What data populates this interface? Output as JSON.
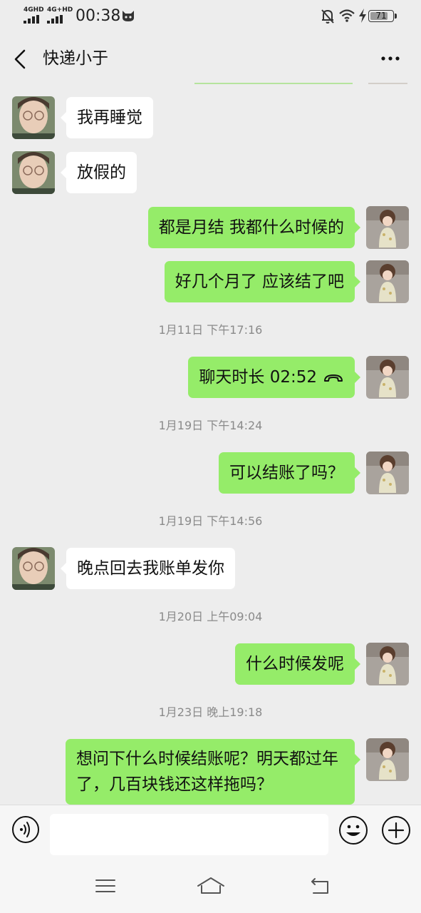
{
  "status_bar": {
    "network_1": "4GHD",
    "network_2": "4G+HD",
    "time": "00:38",
    "battery": "71"
  },
  "header": {
    "title": "快递小于",
    "back_icon": "chevron-left-icon",
    "more_icon": "more-dots-icon"
  },
  "messages": [
    {
      "side": "in",
      "text": "我再睡觉"
    },
    {
      "side": "in",
      "text": "放假的"
    },
    {
      "side": "out",
      "text": "都是月结 我都什么时候的"
    },
    {
      "side": "out",
      "text": "好几个月了  应该结了吧"
    },
    {
      "timestamp": "1月11日 下午17:16"
    },
    {
      "side": "out",
      "text": "聊天时长 02:52",
      "icon": "call-ended-icon"
    },
    {
      "timestamp": "1月19日 下午14:24"
    },
    {
      "side": "out",
      "text": "可以结账了吗？"
    },
    {
      "timestamp": "1月19日 下午14:56"
    },
    {
      "side": "in",
      "text": "晚点回去我账单发你"
    },
    {
      "timestamp": "1月20日 上午09:04"
    },
    {
      "side": "out",
      "text": "什么时候发呢"
    },
    {
      "timestamp": "1月23日 晚上19:18"
    },
    {
      "side": "out",
      "text": "想问下什么时候结账呢？明天都过年了，几百块钱还这样拖吗？"
    }
  ],
  "input_bar": {
    "placeholder": "",
    "voice_icon": "voice-icon",
    "emoji_icon": "emoji-icon",
    "plus_icon": "plus-icon"
  },
  "nav_bar": {
    "menu_icon": "menu-icon",
    "home_icon": "home-icon",
    "back_icon": "back-icon"
  },
  "colors": {
    "background": "#ededed",
    "outgoing_bubble": "#95ec69",
    "incoming_bubble": "#ffffff",
    "timestamp": "#8a8a8a"
  }
}
